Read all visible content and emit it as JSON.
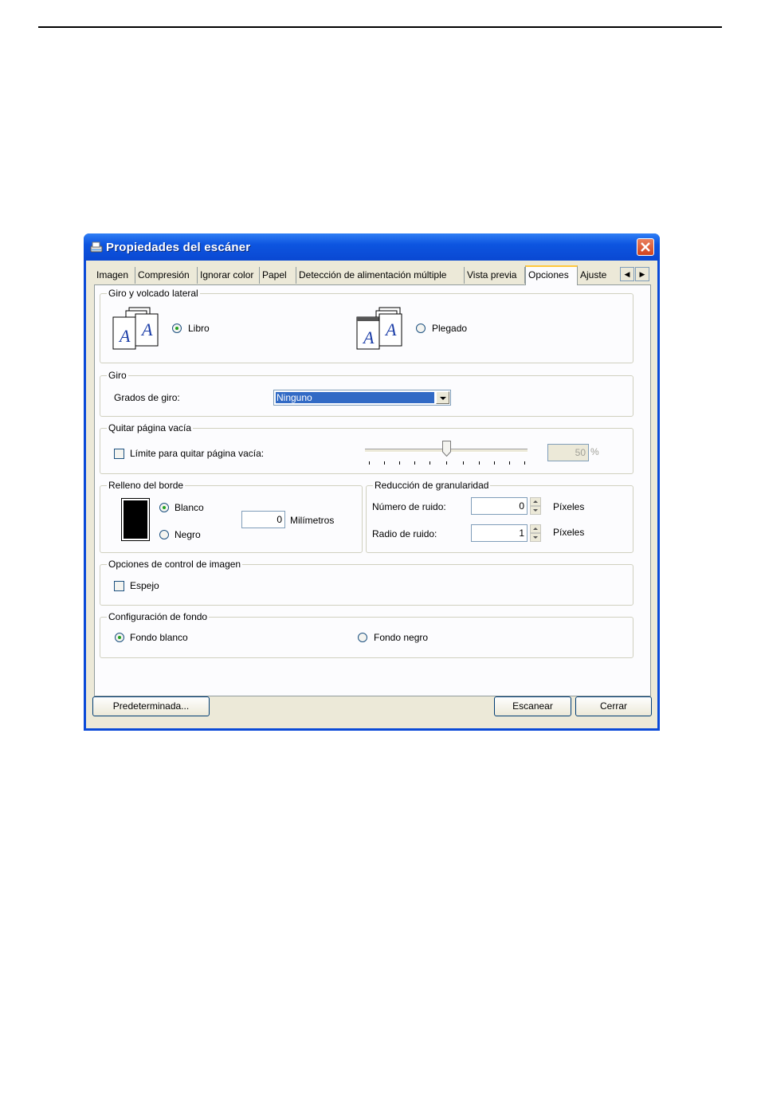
{
  "window": {
    "title": "Propiedades del escáner"
  },
  "tabs": [
    {
      "label": "Imagen"
    },
    {
      "label": "Compresión"
    },
    {
      "label": "Ignorar color"
    },
    {
      "label": "Papel"
    },
    {
      "label": "Detección de alimentación múltiple"
    },
    {
      "label": "Vista previa"
    },
    {
      "label": "Opciones",
      "active": true
    },
    {
      "label": "Ajuste"
    }
  ],
  "rotate_flip": {
    "label": "Giro y volcado lateral",
    "book_label": "Libro",
    "book_selected": true,
    "fold_label": "Plegado",
    "fold_selected": false,
    "page_letter": "A"
  },
  "rotation": {
    "label": "Giro",
    "degrees_label": "Grados de giro:",
    "degrees_value": "Ninguno"
  },
  "blank_page": {
    "label": "Quitar página vacía",
    "threshold_label": "Límite para quitar página vacía:",
    "threshold_checked": false,
    "threshold_value": "50",
    "unit": "%"
  },
  "edge_fill": {
    "label": "Relleno del borde",
    "white_label": "Blanco",
    "white_selected": true,
    "black_label": "Negro",
    "black_selected": false,
    "value": "0",
    "unit": "Milímetros"
  },
  "noise_reduction": {
    "label": "Reducción de granularidad",
    "count_label": "Número de ruido:",
    "count_value": "0",
    "count_unit": "Píxeles",
    "radius_label": "Radio de ruido:",
    "radius_value": "1",
    "radius_unit": "Píxeles"
  },
  "image_control": {
    "label": "Opciones de control de imagen",
    "mirror_label": "Espejo",
    "mirror_checked": false
  },
  "background": {
    "label": "Configuración de fondo",
    "white_label": "Fondo blanco",
    "white_selected": true,
    "black_label": "Fondo negro",
    "black_selected": false
  },
  "buttons": {
    "default_label": "Predeterminada...",
    "scan_label": "Escanear",
    "close_label": "Cerrar"
  },
  "colors": {
    "title_bar": "#0a4ad8",
    "client_bg": "#ece9d8",
    "panel_bg": "#fcfcfe",
    "selection": "#316ac5",
    "active_tab_highlight": "#ffc83c"
  }
}
